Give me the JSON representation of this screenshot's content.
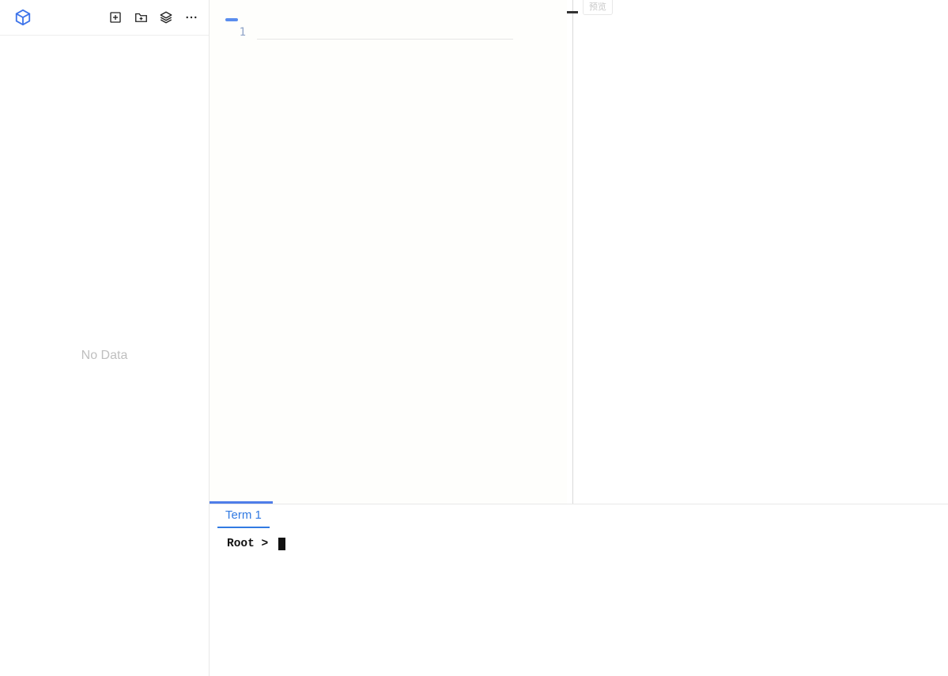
{
  "sidebar": {
    "empty_message": "No Data"
  },
  "editor": {
    "line_numbers": [
      "1"
    ]
  },
  "preview": {
    "button_label": "预览"
  },
  "terminal": {
    "tabs": [
      "Term 1"
    ],
    "prompt": "Root > "
  }
}
